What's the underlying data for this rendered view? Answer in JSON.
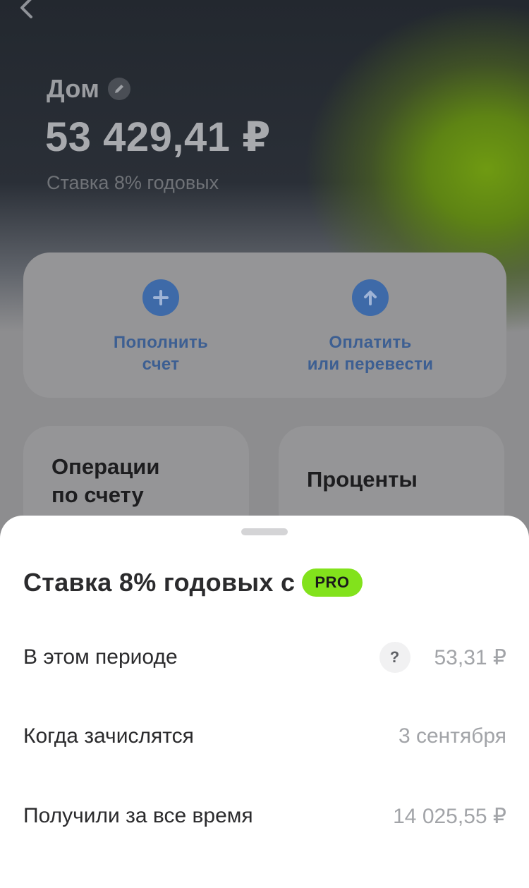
{
  "account": {
    "name": "Дом",
    "balance": "53 429,41 ₽",
    "rate": "Ставка 8% годовых"
  },
  "actions": {
    "top_up_label": "Пополнить счет",
    "top_up_line1": "Пополнить",
    "top_up_line2": "счет",
    "pay_line1": "Оплатить",
    "pay_line2": "или перевести"
  },
  "tiles": {
    "operations_line1": "Операции",
    "operations_line2": "по счету",
    "interest": "Проценты"
  },
  "sheet": {
    "title": "Ставка 8% годовых с",
    "badge": "PRO",
    "rows": [
      {
        "label": "В этом периоде",
        "value": "53,31 ₽",
        "help": "?"
      },
      {
        "label": "Когда зачислятся",
        "value": "3 сентября"
      },
      {
        "label": "Получили за все время",
        "value": "14 025,55 ₽"
      }
    ]
  },
  "icons": {
    "back": "chevron-left-icon",
    "edit": "pencil-icon",
    "top_up": "plus-icon",
    "pay": "arrow-up-icon",
    "help": "question-icon"
  },
  "colors": {
    "accent_blue": "#3e6aa8",
    "pro_green": "#82e21c"
  }
}
